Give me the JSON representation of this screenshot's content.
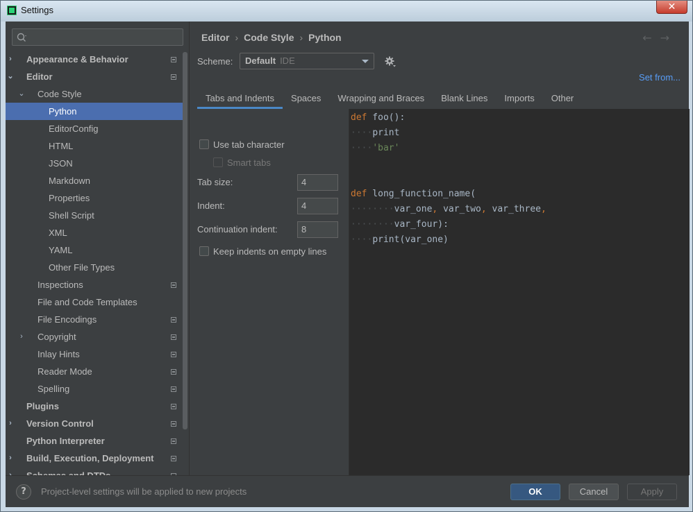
{
  "window": {
    "title": "Settings",
    "close_glyph": "✕"
  },
  "search": {
    "placeholder": ""
  },
  "sidebar": {
    "items": [
      {
        "label": "Appearance & Behavior",
        "level": 0,
        "arrow": "›",
        "bold": true,
        "project": true
      },
      {
        "label": "Editor",
        "level": 0,
        "arrow": "⌄",
        "bold": true,
        "project": true
      },
      {
        "label": "Code Style",
        "level": 1,
        "arrow": "⌄",
        "bold": false,
        "project": false
      },
      {
        "label": "Python",
        "level": 2,
        "arrow": "",
        "bold": false,
        "project": false,
        "selected": true
      },
      {
        "label": "EditorConfig",
        "level": 2,
        "arrow": "",
        "bold": false,
        "project": false
      },
      {
        "label": "HTML",
        "level": 2,
        "arrow": "",
        "bold": false,
        "project": false
      },
      {
        "label": "JSON",
        "level": 2,
        "arrow": "",
        "bold": false,
        "project": false
      },
      {
        "label": "Markdown",
        "level": 2,
        "arrow": "",
        "bold": false,
        "project": false
      },
      {
        "label": "Properties",
        "level": 2,
        "arrow": "",
        "bold": false,
        "project": false
      },
      {
        "label": "Shell Script",
        "level": 2,
        "arrow": "",
        "bold": false,
        "project": false
      },
      {
        "label": "XML",
        "level": 2,
        "arrow": "",
        "bold": false,
        "project": false
      },
      {
        "label": "YAML",
        "level": 2,
        "arrow": "",
        "bold": false,
        "project": false
      },
      {
        "label": "Other File Types",
        "level": 2,
        "arrow": "",
        "bold": false,
        "project": false
      },
      {
        "label": "Inspections",
        "level": 1,
        "arrow": "",
        "bold": false,
        "project": true
      },
      {
        "label": "File and Code Templates",
        "level": 1,
        "arrow": "",
        "bold": false,
        "project": false
      },
      {
        "label": "File Encodings",
        "level": 1,
        "arrow": "",
        "bold": false,
        "project": true
      },
      {
        "label": "Copyright",
        "level": 1,
        "arrow": "›",
        "bold": false,
        "project": true
      },
      {
        "label": "Inlay Hints",
        "level": 1,
        "arrow": "",
        "bold": false,
        "project": true
      },
      {
        "label": "Reader Mode",
        "level": 1,
        "arrow": "",
        "bold": false,
        "project": true
      },
      {
        "label": "Spelling",
        "level": 1,
        "arrow": "",
        "bold": false,
        "project": true
      },
      {
        "label": "Plugins",
        "level": 0,
        "arrow": "",
        "bold": true,
        "project": true
      },
      {
        "label": "Version Control",
        "level": 0,
        "arrow": "›",
        "bold": true,
        "project": true
      },
      {
        "label": "Python Interpreter",
        "level": 0,
        "arrow": "",
        "bold": true,
        "project": true
      },
      {
        "label": "Build, Execution, Deployment",
        "level": 0,
        "arrow": "›",
        "bold": true,
        "project": true
      },
      {
        "label": "Schemas and DTDs",
        "level": 0,
        "arrow": "›",
        "bold": true,
        "project": true
      }
    ]
  },
  "breadcrumb": {
    "part1": "Editor",
    "part2": "Code Style",
    "part3": "Python",
    "sep": "›"
  },
  "nav": {
    "back": "←",
    "forward": "→"
  },
  "scheme": {
    "label": "Scheme:",
    "name": "Default",
    "kind": "IDE",
    "set_from": "Set from..."
  },
  "tabs": [
    "Tabs and Indents",
    "Spaces",
    "Wrapping and Braces",
    "Blank Lines",
    "Imports",
    "Other"
  ],
  "options": {
    "use_tab": "Use tab character",
    "smart_tabs": "Smart tabs",
    "tab_size_label": "Tab size:",
    "tab_size": "4",
    "indent_label": "Indent:",
    "indent": "4",
    "continuation_label": "Continuation indent:",
    "continuation": "8",
    "keep_indents": "Keep indents on empty lines"
  },
  "code": {
    "l1_kw": "def",
    "l1_rest": " foo():",
    "l2_ws": "····",
    "l2_rest": "print",
    "l3_ws": "····",
    "l3_str": "'bar'",
    "l6_kw": "def",
    "l6_rest": " long_function_name(",
    "l7_ws": "········",
    "l7_a": "var_one",
    "l7_b": " var_two",
    "l7_c": " var_three",
    "comma": ",",
    "l8_ws": "········",
    "l8_rest": "var_four):",
    "l9_ws": "····",
    "l9_rest": "print(var_one)"
  },
  "footer": {
    "help": "?",
    "status": "Project-level settings will be applied to new projects",
    "ok": "OK",
    "cancel": "Cancel",
    "apply": "Apply"
  },
  "colors": {
    "accent": "#4b6eaf",
    "link": "#589df6",
    "keyword": "#cc7832",
    "string": "#6a8759"
  }
}
